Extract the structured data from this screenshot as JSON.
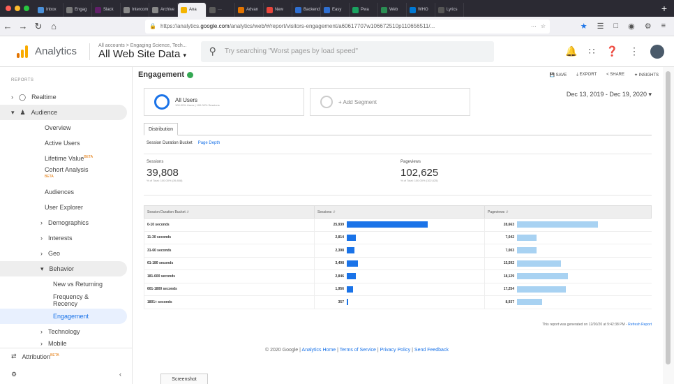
{
  "browser": {
    "tabs": [
      {
        "label": "Inbox",
        "color": "#4a90d9"
      },
      {
        "label": "Engag",
        "color": "#7a7a7a"
      },
      {
        "label": "Slack",
        "color": "#611f69"
      },
      {
        "label": "Intercom",
        "color": "#888888"
      },
      {
        "label": "Archive",
        "color": "#888888"
      },
      {
        "label": "Ana",
        "color": "#f4b400",
        "active": true
      },
      {
        "label": "···",
        "color": "#5b5b5b"
      },
      {
        "label": "Advan",
        "color": "#e37400"
      },
      {
        "label": "New",
        "color": "#e8453c"
      },
      {
        "label": "Backend",
        "color": "#2f6fd1"
      },
      {
        "label": "Easy",
        "color": "#2f6fd1"
      },
      {
        "label": "Pwa",
        "color": "#1aa260"
      },
      {
        "label": "Web",
        "color": "#2a8d53"
      },
      {
        "label": "WHO",
        "color": "#0078d4"
      },
      {
        "label": "Lyrics",
        "color": "#555555"
      }
    ],
    "url_prefix": "https://analytics.",
    "url_domain": "google.com",
    "url_rest": "/analytics/web/#/report/visitors-engagement/a60617707w106672510p110656511/...",
    "url_menu": "···"
  },
  "header": {
    "app_name": "Analytics",
    "breadcrumb": "All accounts > Engaging Science, Tech...",
    "property": "All Web Site Data",
    "search_placeholder": "Try searching \"Worst pages by load speed\""
  },
  "sidebar": {
    "reports_label": "REPORTS",
    "items": [
      {
        "label": "Realtime"
      },
      {
        "label": "Audience"
      },
      {
        "label": "Overview"
      },
      {
        "label": "Active Users"
      },
      {
        "label": "Lifetime Value",
        "badge": "BETA"
      },
      {
        "label": "Cohort Analysis",
        "badge": "BETA"
      },
      {
        "label": "Audiences"
      },
      {
        "label": "User Explorer"
      },
      {
        "label": "Demographics"
      },
      {
        "label": "Interests"
      },
      {
        "label": "Geo"
      },
      {
        "label": "Behavior"
      },
      {
        "label": "New vs Returning"
      },
      {
        "label": "Frequency & Recency"
      },
      {
        "label": "Engagement"
      },
      {
        "label": "Technology"
      },
      {
        "label": "Mobile"
      }
    ],
    "attribution": "Attribution",
    "attribution_badge": "BETA"
  },
  "report": {
    "title": "Engagement",
    "actions": [
      "SAVE",
      "EXPORT",
      "SHARE",
      "INSIGHTS"
    ],
    "segment_name": "All Users",
    "segment_sub": "100.00% Users | 100.00% Sessions",
    "add_segment": "+ Add Segment",
    "date_range": "Dec 13, 2019 - Dec 19, 2020",
    "tab": "Distribution",
    "dist_label": "Session Duration Bucket",
    "dist_link": "Page Depth",
    "metrics": [
      {
        "label": "Sessions",
        "value": "39,808",
        "pct": "% of Total: 100.00% (39,808)"
      },
      {
        "label": "Pageviews",
        "value": "102,625",
        "pct": "% of Total: 100.00% (102,625)"
      }
    ],
    "table": {
      "headers": [
        "Session Duration Bucket",
        "Sessions",
        "Pageviews"
      ],
      "rows": [
        {
          "bucket": "0-10 seconds",
          "sessions": "25,939",
          "sessions_v": 25939,
          "pageviews": "28,663",
          "pageviews_v": 28663
        },
        {
          "bucket": "11-30 seconds",
          "sessions": "2,814",
          "sessions_v": 2814,
          "pageviews": "7,042",
          "pageviews_v": 7042
        },
        {
          "bucket": "31-60 seconds",
          "sessions": "2,398",
          "sessions_v": 2398,
          "pageviews": "7,003",
          "pageviews_v": 7003
        },
        {
          "bucket": "61-180 seconds",
          "sessions": "3,498",
          "sessions_v": 3498,
          "pageviews": "15,592",
          "pageviews_v": 15592
        },
        {
          "bucket": "181-600 seconds",
          "sessions": "2,846",
          "sessions_v": 2846,
          "pageviews": "18,129",
          "pageviews_v": 18129
        },
        {
          "bucket": "601-1800 seconds",
          "sessions": "1,956",
          "sessions_v": 1956,
          "pageviews": "17,254",
          "pageviews_v": 17254
        },
        {
          "bucket": "1801+ seconds",
          "sessions": "357",
          "sessions_v": 357,
          "pageviews": "8,937",
          "pageviews_v": 8937
        }
      ]
    },
    "note": "This report was generated on 12/20/20 at 9:42:38 PM -",
    "note_link": "Refresh Report"
  },
  "footer": {
    "copyright": "© 2020 Google |",
    "links": [
      "Analytics Home",
      "Terms of Service",
      "Privacy Policy",
      "Send Feedback"
    ]
  },
  "screenshot_button": "Screenshot",
  "colors": {
    "sessions_bar": "#1a73e8",
    "pageviews_bar": "#a8d2f2",
    "accent": "#1a73e8"
  }
}
